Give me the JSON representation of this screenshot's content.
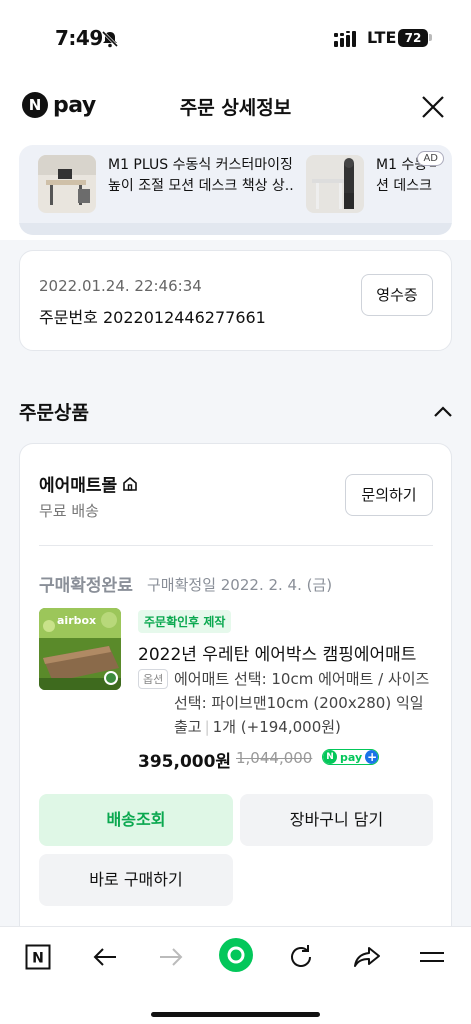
{
  "status_bar": {
    "time": "7:49",
    "network": "LTE",
    "battery": "72"
  },
  "header": {
    "logo_letter": "N",
    "logo_text": "pay",
    "title": "주문 상세정보"
  },
  "ads": {
    "badge": "AD",
    "items": [
      {
        "line1": "M1 PLUS 수동식 커스터마이징",
        "line2": "높이 조절 모션 데스크 책상 상..."
      },
      {
        "line1": "M1 수동식",
        "line2": "션 데스크"
      }
    ]
  },
  "order": {
    "date": "2022.01.24. 22:46:34",
    "number_label": "주문번호",
    "number": "2022012446277661",
    "receipt_button": "영수증"
  },
  "section": {
    "title": "주문상품"
  },
  "seller": {
    "name": "에어매트몰",
    "shipping": "무료 배송",
    "inquiry_button": "문의하기"
  },
  "item": {
    "status": "구매확정완료",
    "status_date": "구매확정일 2022. 2. 4. (금)",
    "tag": "주문확인후 제작",
    "image_brand": "airbox",
    "name": "2022년 우레탄 에어박스 캠핑에어매트",
    "option_label": "옵션",
    "option_line1": "에어매트 선택: 10cm 에어매트 / 사이즈",
    "option_line2": "선택: 파이브맨10cm (200x280) 익일",
    "option_line3a": "출고",
    "option_line3b": "1개 (+194,000원)",
    "price": "395,000원",
    "original_price": "1,044,000",
    "npay_letter": "N",
    "npay_text": "pay"
  },
  "buttons": {
    "delivery": "배송조회",
    "cart": "장바구니 담기",
    "buy": "바로 구매하기"
  },
  "bottom_nav": {
    "home_letter": "N",
    "accent": "#03c75a"
  }
}
